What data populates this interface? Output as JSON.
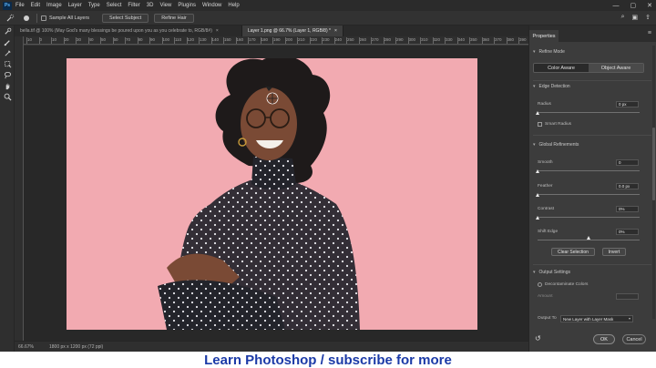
{
  "app": {
    "logo": "Ps"
  },
  "menubar": {
    "items": [
      "File",
      "Edit",
      "Image",
      "Layer",
      "Type",
      "Select",
      "Filter",
      "3D",
      "View",
      "Plugins",
      "Window",
      "Help"
    ],
    "window_controls": [
      "—",
      "▢",
      "✕"
    ]
  },
  "options_bar": {
    "tool_icon": "quick-selection-icon",
    "sample_all_layers": "Sample All Layers",
    "select_subject": "Select Subject",
    "refine_hair": "Refine Hair"
  },
  "tabs": [
    {
      "label": "bella.tif @ 100% (May God's many blessings be poured upon you as you celebrate to, RGB/8#)",
      "close": "×",
      "active": false
    },
    {
      "label": "Layer 1.png @ 66.7% (Layer 1, RGB/8) *",
      "close": "×",
      "active": true
    }
  ],
  "ruler": {
    "ticks": [
      "10",
      "0",
      "10",
      "20",
      "30",
      "40",
      "50",
      "60",
      "70",
      "80",
      "90",
      "100",
      "110",
      "120",
      "130",
      "140",
      "150",
      "160",
      "170",
      "180",
      "190",
      "200",
      "210",
      "220",
      "230",
      "240",
      "250",
      "260",
      "270",
      "280",
      "290",
      "300",
      "310",
      "320",
      "330",
      "340",
      "350",
      "360",
      "370",
      "380",
      "390",
      "400"
    ]
  },
  "status": {
    "zoom": "66.67%",
    "doc_info": "1800 px x 1200 px (72 ppi)"
  },
  "properties": {
    "title": "Properties",
    "refine_mode": {
      "heading": "Refine Mode",
      "color_aware": "Color Aware",
      "object_aware": "Object Aware"
    },
    "edge_detection": {
      "heading": "Edge Detection",
      "radius_label": "Radius",
      "radius_value": "0 px",
      "radius_level": 0,
      "smart_radius": "Smart Radius"
    },
    "global_refinements": {
      "heading": "Global Refinements",
      "smooth_label": "Smooth",
      "smooth_value": "0",
      "smooth_level": 0,
      "feather_label": "Feather",
      "feather_value": "0.0 px",
      "feather_level": 0,
      "contrast_label": "Contrast",
      "contrast_value": "0%",
      "contrast_level": 0,
      "shift_edge_label": "Shift Edge",
      "shift_edge_value": "0%",
      "shift_edge_level": 0.5,
      "clear_selection": "Clear Selection",
      "invert": "Invert"
    },
    "output_settings": {
      "heading": "Output Settings",
      "decontaminate": "Decontaminate Colors",
      "amount_label": "Amount",
      "output_to_label": "Output To",
      "output_to_value": "New Layer with Layer Mask"
    },
    "ok": "OK",
    "cancel": "Cancel"
  },
  "caption": "Learn Photoshop / subscribe for more",
  "colors": {
    "canvas_background": "#f2aab1",
    "caption_text": "#1b3aa7",
    "app_background": "#3a3a3a"
  }
}
